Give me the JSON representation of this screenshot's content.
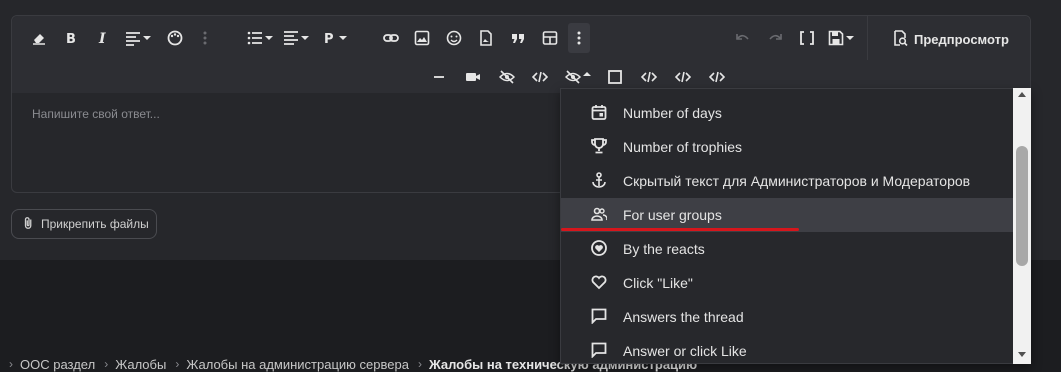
{
  "editor": {
    "placeholder": "Напишите свой ответ...",
    "preview_label": "Предпросмотр",
    "toolbar1_icons": [
      "eraser-icon",
      "bold-icon",
      "italic-icon",
      "align-icon",
      "palette-icon",
      "more-vertical-icon",
      "list-icon",
      "text-align-icon",
      "paragraph-icon",
      "link-icon",
      "image-icon",
      "smile-icon",
      "file-image-icon",
      "quote-icon",
      "table-icon",
      "more-vertical-icon",
      "undo-icon",
      "redo-icon",
      "brackets-icon",
      "save-icon"
    ],
    "toolbar2_icons": [
      "minus-icon",
      "video-icon",
      "eye-off-icon",
      "code-icon",
      "eye-off-icon",
      "square-icon",
      "code-icon",
      "code-icon",
      "code-icon"
    ]
  },
  "attach": {
    "label": "Прикрепить файлы"
  },
  "dropdown": {
    "items": [
      {
        "label": "Number of days",
        "icon": "calendar-icon"
      },
      {
        "label": "Number of trophies",
        "icon": "trophy-icon"
      },
      {
        "label": "Скрытый текст для Администраторов и Модераторов",
        "icon": "anchor-icon"
      },
      {
        "label": "For user groups",
        "icon": "users-icon"
      },
      {
        "label": "By the reacts",
        "icon": "heart-circle-icon"
      },
      {
        "label": "Click \"Like\"",
        "icon": "heart-icon"
      },
      {
        "label": "Answers the thread",
        "icon": "comment-icon"
      },
      {
        "label": "Answer or click Like",
        "icon": "comment-icon"
      }
    ],
    "hovered_index": 3,
    "underline_color": "#d6161c"
  },
  "breadcrumb": {
    "items": [
      "OOC раздел",
      "Жалобы",
      "Жалобы на администрацию сервера",
      "Жалобы на техническую администрацию"
    ]
  }
}
